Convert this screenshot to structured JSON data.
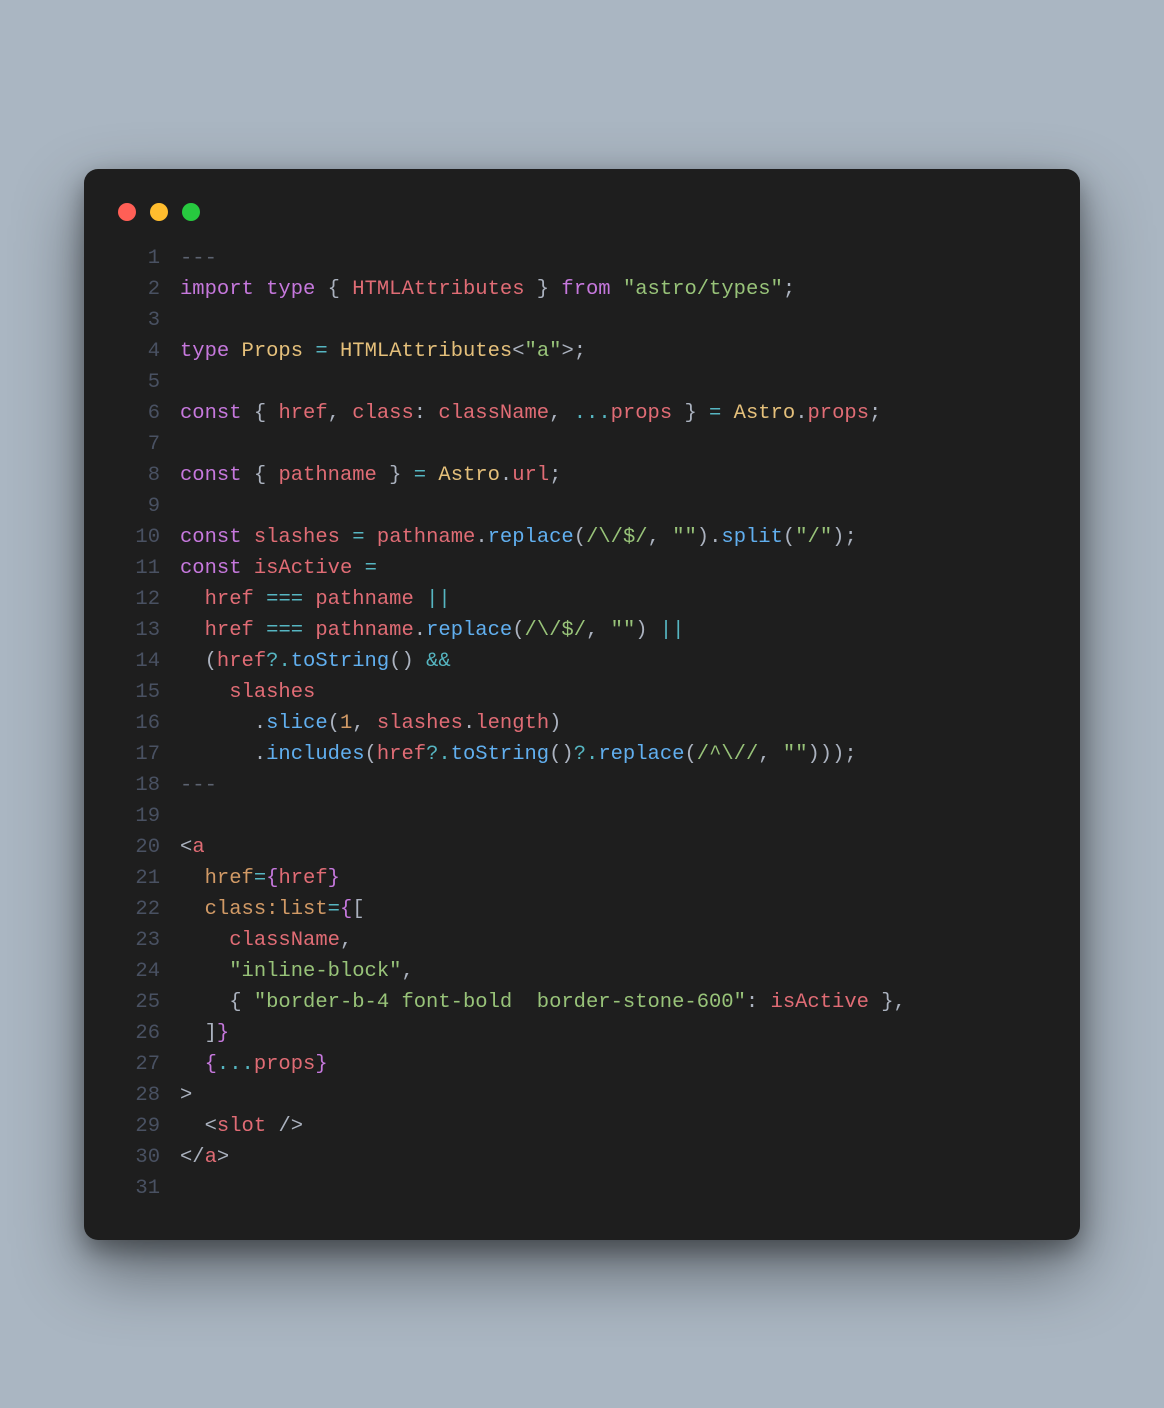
{
  "window": {
    "traffic_lights": [
      "red",
      "yellow",
      "green"
    ]
  },
  "code": {
    "lines": [
      {
        "n": 1,
        "tokens": [
          [
            "c-comment",
            "---"
          ]
        ]
      },
      {
        "n": 2,
        "tokens": [
          [
            "c-kw",
            "import"
          ],
          [
            "",
            " "
          ],
          [
            "c-kw",
            "type"
          ],
          [
            "",
            " "
          ],
          [
            "c-punc",
            "{ "
          ],
          [
            "c-id",
            "HTMLAttributes"
          ],
          [
            "c-punc",
            " } "
          ],
          [
            "c-kw",
            "from"
          ],
          [
            "",
            " "
          ],
          [
            "c-str",
            "\"astro/types\""
          ],
          [
            "c-punc",
            ";"
          ]
        ]
      },
      {
        "n": 3,
        "tokens": [
          [
            "",
            ""
          ]
        ]
      },
      {
        "n": 4,
        "tokens": [
          [
            "c-kw",
            "type"
          ],
          [
            "",
            " "
          ],
          [
            "c-name",
            "Props"
          ],
          [
            "",
            " "
          ],
          [
            "c-op",
            "="
          ],
          [
            "",
            " "
          ],
          [
            "c-name",
            "HTMLAttributes"
          ],
          [
            "c-punc",
            "<"
          ],
          [
            "c-str",
            "\"a\""
          ],
          [
            "c-punc",
            ">;"
          ]
        ]
      },
      {
        "n": 5,
        "tokens": [
          [
            "",
            ""
          ]
        ]
      },
      {
        "n": 6,
        "tokens": [
          [
            "c-kw",
            "const"
          ],
          [
            "",
            " "
          ],
          [
            "c-punc",
            "{ "
          ],
          [
            "c-id",
            "href"
          ],
          [
            "c-punc",
            ", "
          ],
          [
            "c-id",
            "class"
          ],
          [
            "c-punc",
            ": "
          ],
          [
            "c-id",
            "className"
          ],
          [
            "c-punc",
            ", "
          ],
          [
            "c-op",
            "..."
          ],
          [
            "c-id",
            "props"
          ],
          [
            "c-punc",
            " } "
          ],
          [
            "c-op",
            "="
          ],
          [
            "",
            " "
          ],
          [
            "c-name",
            "Astro"
          ],
          [
            "c-punc",
            "."
          ],
          [
            "c-id",
            "props"
          ],
          [
            "c-punc",
            ";"
          ]
        ]
      },
      {
        "n": 7,
        "tokens": [
          [
            "",
            ""
          ]
        ]
      },
      {
        "n": 8,
        "tokens": [
          [
            "c-kw",
            "const"
          ],
          [
            "",
            " "
          ],
          [
            "c-punc",
            "{ "
          ],
          [
            "c-id",
            "pathname"
          ],
          [
            "c-punc",
            " } "
          ],
          [
            "c-op",
            "="
          ],
          [
            "",
            " "
          ],
          [
            "c-name",
            "Astro"
          ],
          [
            "c-punc",
            "."
          ],
          [
            "c-id",
            "url"
          ],
          [
            "c-punc",
            ";"
          ]
        ]
      },
      {
        "n": 9,
        "tokens": [
          [
            "",
            ""
          ]
        ]
      },
      {
        "n": 10,
        "tokens": [
          [
            "c-kw",
            "const"
          ],
          [
            "",
            " "
          ],
          [
            "c-id",
            "slashes"
          ],
          [
            "",
            " "
          ],
          [
            "c-op",
            "="
          ],
          [
            "",
            " "
          ],
          [
            "c-id",
            "pathname"
          ],
          [
            "c-punc",
            "."
          ],
          [
            "c-fn",
            "replace"
          ],
          [
            "c-punc",
            "("
          ],
          [
            "c-regex",
            "/\\/$/"
          ],
          [
            "c-punc",
            ", "
          ],
          [
            "c-str",
            "\"\""
          ],
          [
            "c-punc",
            ")."
          ],
          [
            "c-fn",
            "split"
          ],
          [
            "c-punc",
            "("
          ],
          [
            "c-str",
            "\"/\""
          ],
          [
            "c-punc",
            ");"
          ]
        ]
      },
      {
        "n": 11,
        "tokens": [
          [
            "c-kw",
            "const"
          ],
          [
            "",
            " "
          ],
          [
            "c-id",
            "isActive"
          ],
          [
            "",
            " "
          ],
          [
            "c-op",
            "="
          ]
        ]
      },
      {
        "n": 12,
        "tokens": [
          [
            "",
            "  "
          ],
          [
            "c-id",
            "href"
          ],
          [
            "",
            " "
          ],
          [
            "c-op",
            "==="
          ],
          [
            "",
            " "
          ],
          [
            "c-id",
            "pathname"
          ],
          [
            "",
            " "
          ],
          [
            "c-op",
            "||"
          ]
        ]
      },
      {
        "n": 13,
        "tokens": [
          [
            "",
            "  "
          ],
          [
            "c-id",
            "href"
          ],
          [
            "",
            " "
          ],
          [
            "c-op",
            "==="
          ],
          [
            "",
            " "
          ],
          [
            "c-id",
            "pathname"
          ],
          [
            "c-punc",
            "."
          ],
          [
            "c-fn",
            "replace"
          ],
          [
            "c-punc",
            "("
          ],
          [
            "c-regex",
            "/\\/$/"
          ],
          [
            "c-punc",
            ", "
          ],
          [
            "c-str",
            "\"\""
          ],
          [
            "c-punc",
            ") "
          ],
          [
            "c-op",
            "||"
          ]
        ]
      },
      {
        "n": 14,
        "tokens": [
          [
            "",
            "  "
          ],
          [
            "c-punc",
            "("
          ],
          [
            "c-id",
            "href"
          ],
          [
            "c-op",
            "?."
          ],
          [
            "c-fn",
            "toString"
          ],
          [
            "c-punc",
            "() "
          ],
          [
            "c-op",
            "&&"
          ]
        ]
      },
      {
        "n": 15,
        "tokens": [
          [
            "",
            "    "
          ],
          [
            "c-id",
            "slashes"
          ]
        ]
      },
      {
        "n": 16,
        "tokens": [
          [
            "",
            "      "
          ],
          [
            "c-punc",
            "."
          ],
          [
            "c-fn",
            "slice"
          ],
          [
            "c-punc",
            "("
          ],
          [
            "c-num",
            "1"
          ],
          [
            "c-punc",
            ", "
          ],
          [
            "c-id",
            "slashes"
          ],
          [
            "c-punc",
            "."
          ],
          [
            "c-id",
            "length"
          ],
          [
            "c-punc",
            ")"
          ]
        ]
      },
      {
        "n": 17,
        "tokens": [
          [
            "",
            "      "
          ],
          [
            "c-punc",
            "."
          ],
          [
            "c-fn",
            "includes"
          ],
          [
            "c-punc",
            "("
          ],
          [
            "c-id",
            "href"
          ],
          [
            "c-op",
            "?."
          ],
          [
            "c-fn",
            "toString"
          ],
          [
            "c-punc",
            "()"
          ],
          [
            "c-op",
            "?."
          ],
          [
            "c-fn",
            "replace"
          ],
          [
            "c-punc",
            "("
          ],
          [
            "c-regex",
            "/^\\//"
          ],
          [
            "c-punc",
            ", "
          ],
          [
            "c-str",
            "\"\""
          ],
          [
            "c-punc",
            ")));"
          ]
        ]
      },
      {
        "n": 18,
        "tokens": [
          [
            "c-comment",
            "---"
          ]
        ]
      },
      {
        "n": 19,
        "tokens": [
          [
            "",
            ""
          ]
        ]
      },
      {
        "n": 20,
        "tokens": [
          [
            "c-punc",
            "<"
          ],
          [
            "c-tag",
            "a"
          ]
        ]
      },
      {
        "n": 21,
        "tokens": [
          [
            "",
            "  "
          ],
          [
            "c-attr",
            "href"
          ],
          [
            "c-op",
            "="
          ],
          [
            "c-brace",
            "{"
          ],
          [
            "c-id",
            "href"
          ],
          [
            "c-brace",
            "}"
          ]
        ]
      },
      {
        "n": 22,
        "tokens": [
          [
            "",
            "  "
          ],
          [
            "c-attr",
            "class:list"
          ],
          [
            "c-op",
            "="
          ],
          [
            "c-brace",
            "{"
          ],
          [
            "c-punc",
            "["
          ]
        ]
      },
      {
        "n": 23,
        "tokens": [
          [
            "",
            "    "
          ],
          [
            "c-id",
            "className"
          ],
          [
            "c-punc",
            ","
          ]
        ]
      },
      {
        "n": 24,
        "tokens": [
          [
            "",
            "    "
          ],
          [
            "c-str",
            "\"inline-block\""
          ],
          [
            "c-punc",
            ","
          ]
        ]
      },
      {
        "n": 25,
        "tokens": [
          [
            "",
            "    "
          ],
          [
            "c-punc",
            "{ "
          ],
          [
            "c-str",
            "\"border-b-4 font-bold  border-stone-600\""
          ],
          [
            "c-punc",
            ": "
          ],
          [
            "c-id",
            "isActive"
          ],
          [
            "c-punc",
            " },"
          ]
        ]
      },
      {
        "n": 26,
        "tokens": [
          [
            "",
            "  "
          ],
          [
            "c-punc",
            "]"
          ],
          [
            "c-brace",
            "}"
          ]
        ]
      },
      {
        "n": 27,
        "tokens": [
          [
            "",
            "  "
          ],
          [
            "c-brace",
            "{"
          ],
          [
            "c-op",
            "..."
          ],
          [
            "c-id",
            "props"
          ],
          [
            "c-brace",
            "}"
          ]
        ]
      },
      {
        "n": 28,
        "tokens": [
          [
            "c-punc",
            ">"
          ]
        ]
      },
      {
        "n": 29,
        "tokens": [
          [
            "",
            "  "
          ],
          [
            "c-punc",
            "<"
          ],
          [
            "c-tag",
            "slot"
          ],
          [
            "",
            " "
          ],
          [
            "c-punc",
            "/>"
          ]
        ]
      },
      {
        "n": 30,
        "tokens": [
          [
            "c-punc",
            "</"
          ],
          [
            "c-tag",
            "a"
          ],
          [
            "c-punc",
            ">"
          ]
        ]
      },
      {
        "n": 31,
        "tokens": [
          [
            "",
            ""
          ]
        ]
      }
    ]
  }
}
